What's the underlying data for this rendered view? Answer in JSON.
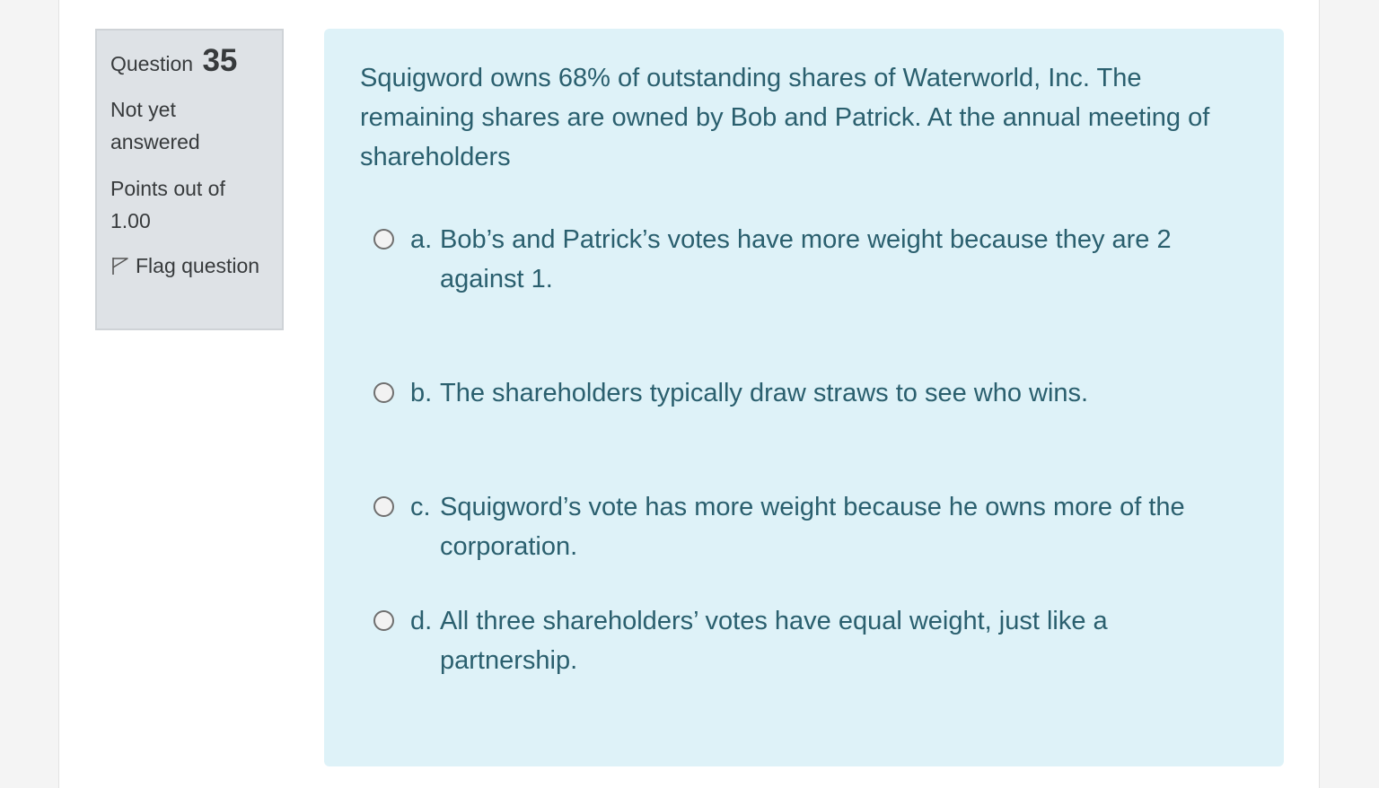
{
  "info": {
    "question_label": "Question",
    "question_number": "35",
    "state": "Not yet answered",
    "grade": "Points out of 1.00",
    "flag_label": "Flag question",
    "flag_icon": "flag-outline-icon"
  },
  "question": {
    "text": "Squigword owns 68% of outstanding shares of Waterworld, Inc. The remaining shares are owned by Bob and Patrick. At the annual meeting of shareholders",
    "answers": [
      {
        "letter": "a.",
        "text": "Bob’s and Patrick’s votes have more weight because they are 2 against 1."
      },
      {
        "letter": "b.",
        "text": "The shareholders typically draw straws to see who wins."
      },
      {
        "letter": "c.",
        "text": "Squigword’s vote has more weight because he owns more of the corporation."
      },
      {
        "letter": "d.",
        "text": "All three shareholders’ votes have equal weight, just like a partnership."
      }
    ]
  },
  "colors": {
    "info_bg": "#dee2e6",
    "content_bg": "#def2f8",
    "content_text": "#2a5f6e",
    "info_text": "#373a3c"
  }
}
